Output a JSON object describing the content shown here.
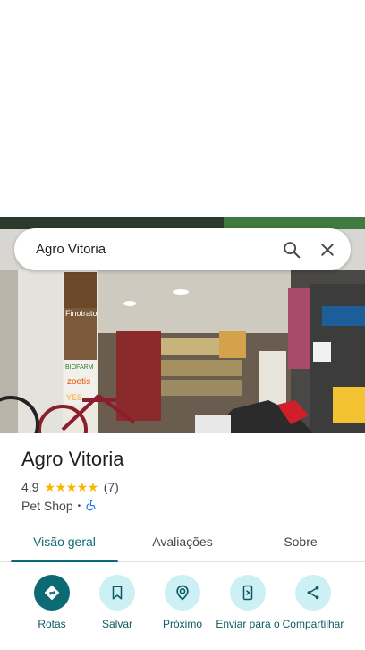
{
  "search": {
    "query": "Agro Vitoria"
  },
  "photo": {
    "signs": {
      "finotrato": "Finotrato",
      "biofarm": "BIOFARM",
      "zoetis": "zoetis",
      "yes": "YES"
    }
  },
  "place": {
    "name": "Agro Vitoria",
    "rating": "4,9",
    "stars": "★★★★★",
    "review_count": "(7)",
    "category": "Pet Shop",
    "separator": "•"
  },
  "tabs": [
    {
      "label": "Visão geral",
      "active": true
    },
    {
      "label": "Avaliações",
      "active": false
    },
    {
      "label": "Sobre",
      "active": false
    }
  ],
  "actions": [
    {
      "label": "Rotas",
      "icon": "directions-icon"
    },
    {
      "label": "Salvar",
      "icon": "bookmark-icon"
    },
    {
      "label": "Próximo",
      "icon": "nearby-icon"
    },
    {
      "label": "Enviar para o",
      "icon": "send-to-phone-icon"
    },
    {
      "label": "Compartilhar",
      "icon": "share-icon"
    }
  ],
  "colors": {
    "accent": "#0b6a73",
    "action_bg": "#ccf0f3",
    "star": "#f8b600",
    "accessible": "#1a73e8"
  }
}
